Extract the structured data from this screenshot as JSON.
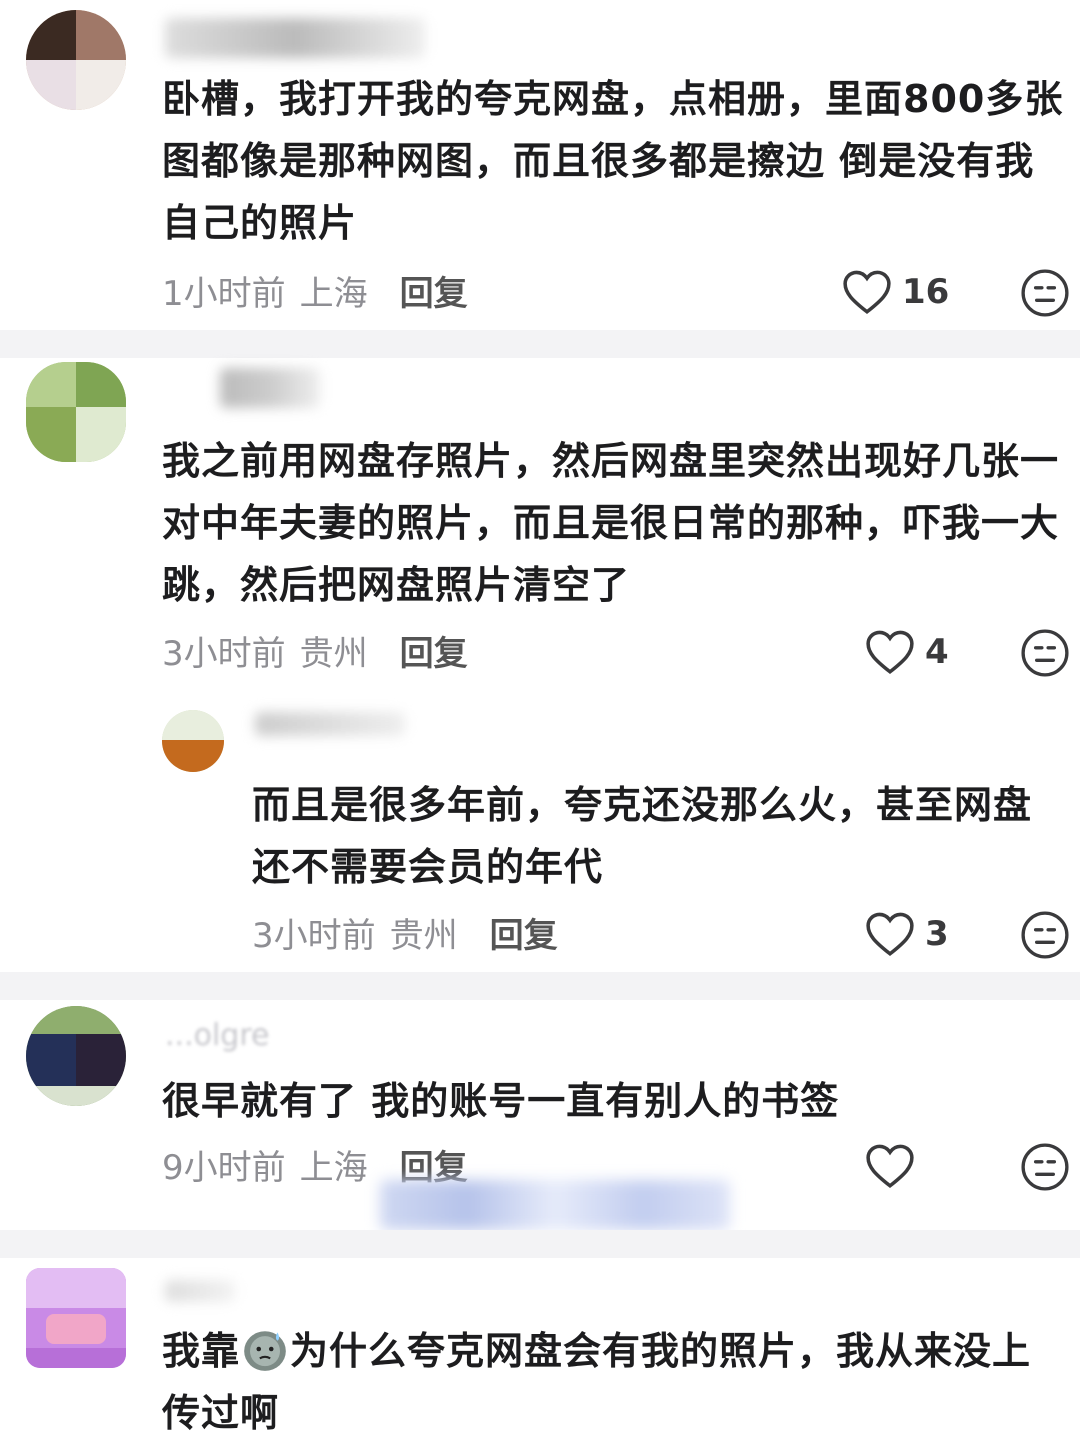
{
  "comments": [
    {
      "content": "卧槽，我打开我的夸克网盘，点相册，里面800多张图都像是那种网图，而且很多都是擦边 倒是没有我自己的照片",
      "time": "1小时前",
      "location": "上海",
      "reply_label": "回复",
      "likes": "16"
    },
    {
      "content": "我之前用网盘存照片，然后网盘里突然出现好几张一对中年夫妻的照片，而且是很日常的那种，吓我一大跳，然后把网盘照片清空了",
      "time": "3小时前",
      "location": "贵州",
      "reply_label": "回复",
      "likes": "4",
      "replies": [
        {
          "content": "而且是很多年前，夸克还没那么火，甚至网盘还不需要会员的年代",
          "time": "3小时前",
          "location": "贵州",
          "reply_label": "回复",
          "likes": "3"
        }
      ]
    },
    {
      "username_fragment": "...olgre",
      "content": "很早就有了 我的账号一直有别人的书签",
      "time": "9小时前",
      "location": "上海",
      "reply_label": "回复",
      "likes": ""
    },
    {
      "content_before_emoji": "我靠",
      "content_after_emoji": "为什么夸克网盘会有我的照片，我从来没上传过啊"
    }
  ],
  "colors": {
    "text": "#1d1d1f",
    "meta": "#8e8e93",
    "divider": "#f3f3f5",
    "icon": "#3a3a3c"
  },
  "icons": [
    "heart-outline-icon",
    "neutral-face-icon",
    "sweat-face-emoji"
  ]
}
